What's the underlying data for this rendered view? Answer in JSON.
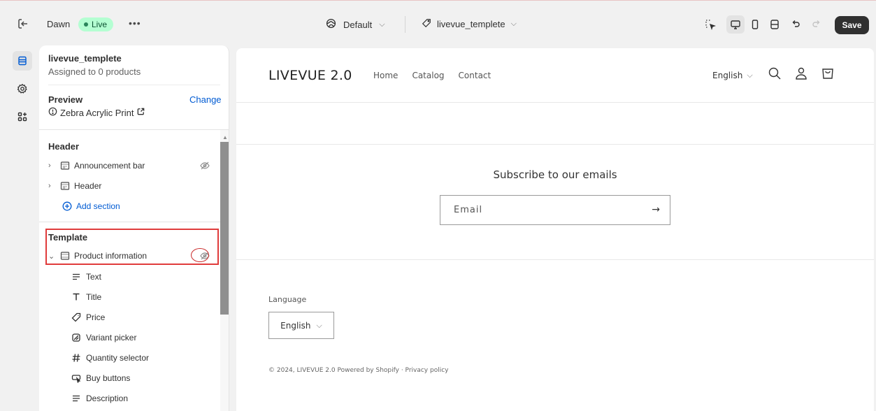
{
  "topbar": {
    "theme_name": "Dawn",
    "live_label": "Live",
    "more_label": "•••",
    "default_label": "Default",
    "template_label": "livevue_templete",
    "save_label": "Save"
  },
  "panel": {
    "title": "livevue_templete",
    "subtitle": "Assigned to 0 products",
    "preview_label": "Preview",
    "change_label": "Change",
    "preview_product": "Zebra Acrylic Print",
    "header_section": {
      "label": "Header",
      "items": [
        {
          "label": "Announcement bar"
        },
        {
          "label": "Header"
        }
      ],
      "add_label": "Add section"
    },
    "template_section": {
      "label": "Template",
      "item_label": "Product information",
      "children": [
        {
          "label": "Text",
          "icon": "text-icon"
        },
        {
          "label": "Title",
          "icon": "title-icon"
        },
        {
          "label": "Price",
          "icon": "price-tag-icon"
        },
        {
          "label": "Variant picker",
          "icon": "variant-icon"
        },
        {
          "label": "Quantity selector",
          "icon": "hash-icon"
        },
        {
          "label": "Buy buttons",
          "icon": "buy-button-icon"
        },
        {
          "label": "Description",
          "icon": "description-icon"
        }
      ]
    }
  },
  "preview": {
    "logo": "LIVEVUE 2.0",
    "nav": [
      "Home",
      "Catalog",
      "Contact"
    ],
    "language": "English",
    "subscribe_heading": "Subscribe to our emails",
    "email_label": "Email",
    "language_label": "Language",
    "language_select": "English",
    "footer": "© 2024, LIVEVUE 2.0 Powered by Shopify  ·  Privacy policy"
  }
}
